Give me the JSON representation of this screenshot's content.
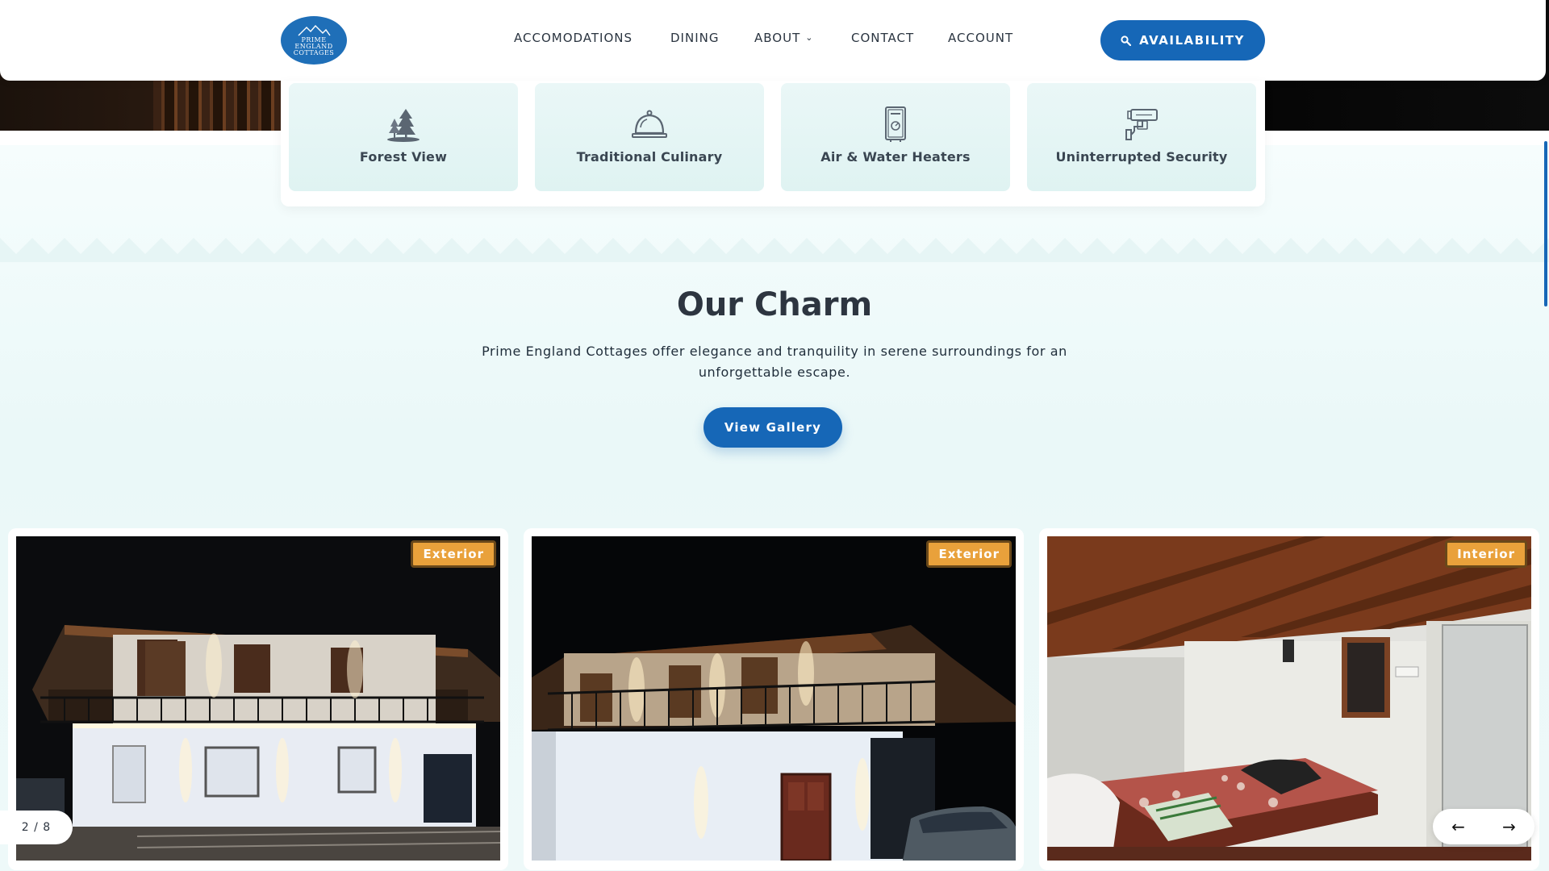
{
  "header": {
    "logo_text": [
      "PRIME",
      "ENGLAND",
      "COTTAGES"
    ],
    "nav": [
      {
        "label": "ACCOMODATIONS",
        "icon": ""
      },
      {
        "label": "DINING",
        "icon": ""
      },
      {
        "label": "ABOUT",
        "icon": "chevron-down-icon"
      },
      {
        "label": "CONTACT",
        "icon": ""
      },
      {
        "label": "ACCOUNT",
        "icon": ""
      }
    ],
    "availability_label": "AVAILABILITY",
    "availability_icon": "search-icon"
  },
  "amenities": [
    {
      "label": "Forest View",
      "icon": "forest-icon"
    },
    {
      "label": "Traditional Culinary",
      "icon": "service-bell-icon"
    },
    {
      "label": "Air & Water Heaters",
      "icon": "water-heater-icon"
    },
    {
      "label": "Uninterrupted Security",
      "icon": "cctv-camera-icon"
    }
  ],
  "charm": {
    "title": "Our Charm",
    "text": "Prime England Cottages offer elegance and tranquility in serene surroundings for an unforgettable escape.",
    "button": "View Gallery"
  },
  "gallery": {
    "cards": [
      {
        "badge": "Exterior",
        "scene": "cottage exterior at night, left view"
      },
      {
        "badge": "Exterior",
        "scene": "cottage exterior at night, right view"
      },
      {
        "badge": "Interior",
        "scene": "bedroom with bed and mirror"
      }
    ],
    "pager": "2 / 8",
    "prev_icon": "arrow-left-icon",
    "next_icon": "arrow-right-icon"
  },
  "colors": {
    "accent": "#1667b7",
    "badge": "#e9a13b",
    "background": "#eef9f9"
  }
}
